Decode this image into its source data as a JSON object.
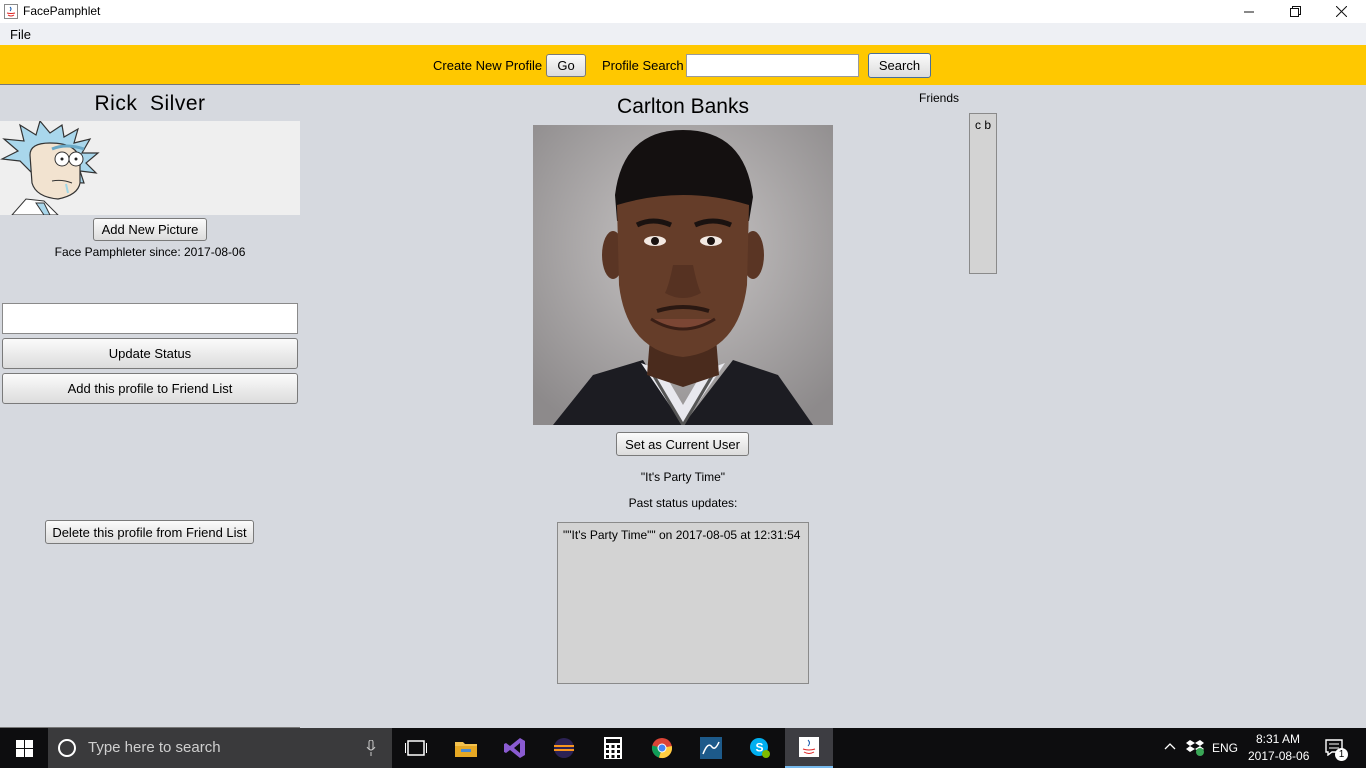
{
  "window": {
    "title": "FacePamphlet",
    "controls": [
      "minimize",
      "restore",
      "close"
    ]
  },
  "menu": {
    "file": "File"
  },
  "toolbar": {
    "create_label": "Create New Profile",
    "go_label": "Go",
    "search_label": "Profile Search",
    "search_value": "",
    "search_button": "Search",
    "bg_color": "#ffc800"
  },
  "left": {
    "name": "Rick  Silver",
    "add_picture": "Add New Picture",
    "since": "Face Pamphleter since: 2017-08-06",
    "status_value": "",
    "update_status": "Update Status",
    "add_friend": "Add this profile to Friend List",
    "delete_friend": "Delete this profile from Friend List"
  },
  "center": {
    "name": "Carlton Banks",
    "set_current": "Set as Current User",
    "status": "\"It's Party Time\"",
    "past_label": "Past status updates:",
    "past_updates": [
      "\"\"It's Party Time\"\" on 2017-08-05 at 12:31:54"
    ]
  },
  "friends": {
    "label": "Friends",
    "items": [
      "c b"
    ]
  },
  "taskbar": {
    "search_placeholder": "Type here to search",
    "apps": [
      "task-view-icon",
      "file-explorer-icon",
      "visual-studio-icon",
      "eclipse-icon",
      "calculator-icon",
      "chrome-icon",
      "mysql-workbench-icon",
      "skype-icon",
      "java-icon"
    ],
    "language": "ENG",
    "time": "8:31 AM",
    "date": "2017-08-06",
    "notifications": "1"
  }
}
